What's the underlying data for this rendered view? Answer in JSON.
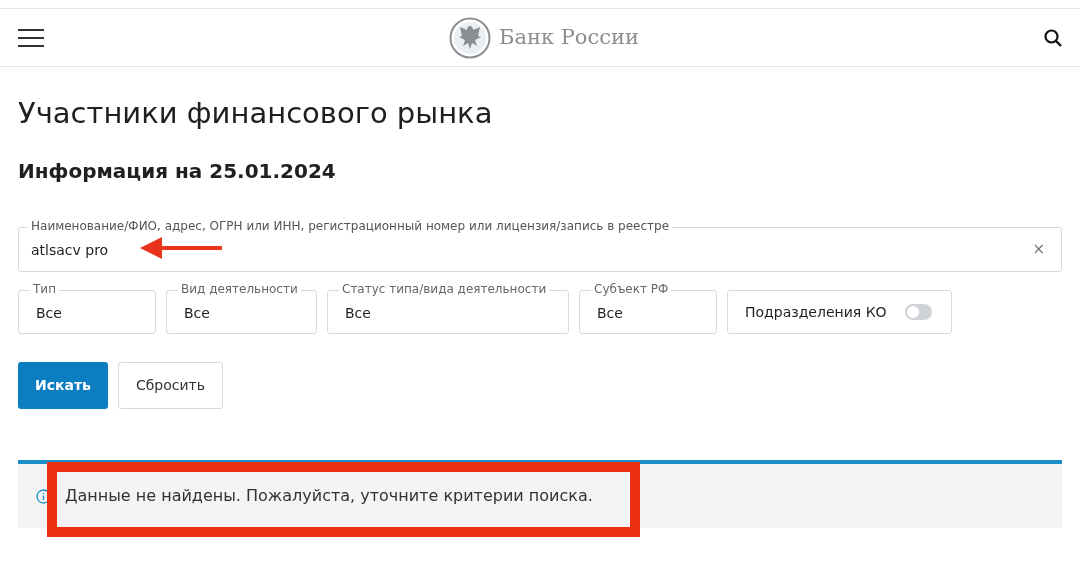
{
  "header": {
    "logo_text": "Банк России"
  },
  "title": "Участники финансового рынка",
  "subtitle": "Информация на 25.01.2024",
  "search": {
    "label": "Наименование/ФИО, адрес, ОГРН или ИНН, регистрационный номер или лицензия/запись в реестре",
    "value": "atlsacv pro",
    "clear": "×"
  },
  "filters": [
    {
      "kind": "select",
      "label": "Тип",
      "value": "Все"
    },
    {
      "kind": "select",
      "label": "Вид деятельности",
      "value": "Все"
    },
    {
      "kind": "select",
      "label": "Статус типа/вида деятельности",
      "value": "Все"
    },
    {
      "kind": "select",
      "label": "Субъект РФ",
      "value": "Все"
    },
    {
      "kind": "toggle",
      "label": "Подразделения КО",
      "on": false
    }
  ],
  "buttons": [
    {
      "kind": "primary",
      "label": "Искать"
    },
    {
      "kind": "secondary",
      "label": "Сбросить"
    }
  ],
  "notice": {
    "text": "Данные не найдены. Пожалуйста, уточните критерии поиска."
  }
}
